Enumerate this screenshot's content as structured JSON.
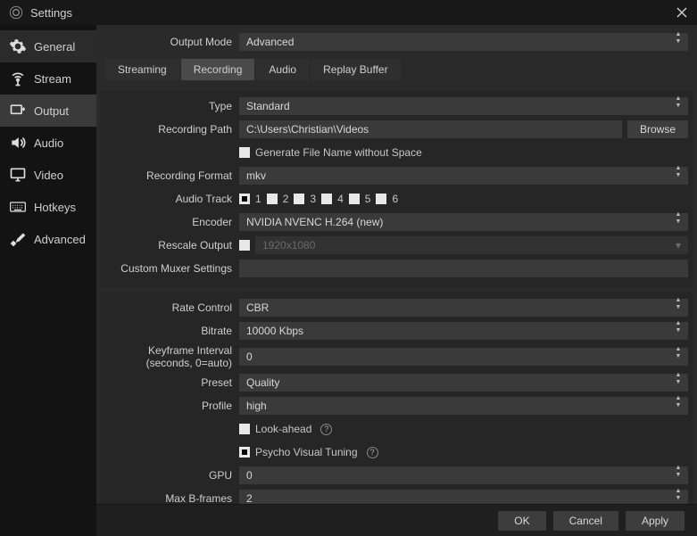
{
  "window": {
    "title": "Settings"
  },
  "sidebar": {
    "items": [
      {
        "label": "General"
      },
      {
        "label": "Stream"
      },
      {
        "label": "Output"
      },
      {
        "label": "Audio"
      },
      {
        "label": "Video"
      },
      {
        "label": "Hotkeys"
      },
      {
        "label": "Advanced"
      }
    ]
  },
  "top": {
    "output_mode_label": "Output Mode",
    "output_mode_value": "Advanced"
  },
  "tabs": {
    "streaming": "Streaming",
    "recording": "Recording",
    "audio": "Audio",
    "replay": "Replay Buffer"
  },
  "rec": {
    "type_label": "Type",
    "type_value": "Standard",
    "path_label": "Recording Path",
    "path_value": "C:\\Users\\Christian\\Videos",
    "browse": "Browse",
    "gen_filename": "Generate File Name without Space",
    "format_label": "Recording Format",
    "format_value": "mkv",
    "audiotrack_label": "Audio Track",
    "tracks": [
      "1",
      "2",
      "3",
      "4",
      "5",
      "6"
    ],
    "encoder_label": "Encoder",
    "encoder_value": "NVIDIA NVENC H.264 (new)",
    "rescale_label": "Rescale Output",
    "rescale_value": "1920x1080",
    "muxer_label": "Custom Muxer Settings",
    "muxer_value": ""
  },
  "enc": {
    "rate_control_label": "Rate Control",
    "rate_control_value": "CBR",
    "bitrate_label": "Bitrate",
    "bitrate_value": "10000 Kbps",
    "keyframe_label": "Keyframe Interval (seconds, 0=auto)",
    "keyframe_value": "0",
    "preset_label": "Preset",
    "preset_value": "Quality",
    "profile_label": "Profile",
    "profile_value": "high",
    "lookahead": "Look-ahead",
    "psycho": "Psycho Visual Tuning",
    "gpu_label": "GPU",
    "gpu_value": "0",
    "bframes_label": "Max B-frames",
    "bframes_value": "2"
  },
  "footer": {
    "ok": "OK",
    "cancel": "Cancel",
    "apply": "Apply"
  }
}
